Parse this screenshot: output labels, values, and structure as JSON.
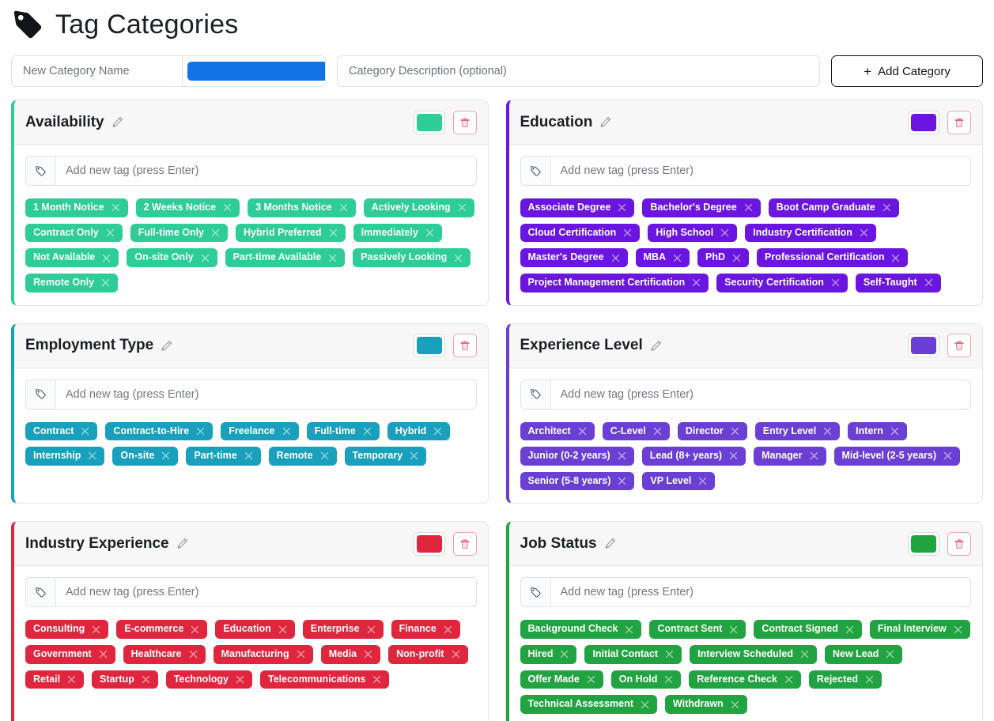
{
  "header": {
    "title": "Tag Categories",
    "logo_icon": "tag-icon"
  },
  "new_category_form": {
    "name_placeholder": "New Category Name",
    "name_value": "",
    "color_value": "#1273e6",
    "description_placeholder": "Category Description (optional)",
    "description_value": "",
    "add_button_label": "Add Category",
    "add_button_plus": "+"
  },
  "tag_input_placeholder": "Add new tag (press Enter)",
  "categories": [
    {
      "name": "Availability",
      "color": "#2ecc96",
      "tags": [
        "1 Month Notice",
        "2 Weeks Notice",
        "3 Months Notice",
        "Actively Looking",
        "Contract Only",
        "Full-time Only",
        "Hybrid Preferred",
        "Immediately",
        "Not Available",
        "On-site Only",
        "Part-time Available",
        "Passively Looking",
        "Remote Only"
      ]
    },
    {
      "name": "Education",
      "color": "#6a16e0",
      "tags": [
        "Associate Degree",
        "Bachelor's Degree",
        "Boot Camp Graduate",
        "Cloud Certification",
        "High School",
        "Industry Certification",
        "Master's Degree",
        "MBA",
        "PhD",
        "Professional Certification",
        "Project Management Certification",
        "Security Certification",
        "Self-Taught"
      ]
    },
    {
      "name": "Employment Type",
      "color": "#18a0bd",
      "tags": [
        "Contract",
        "Contract-to-Hire",
        "Freelance",
        "Full-time",
        "Hybrid",
        "Internship",
        "On-site",
        "Part-time",
        "Remote",
        "Temporary"
      ]
    },
    {
      "name": "Experience Level",
      "color": "#6b3fd4",
      "tags": [
        "Architect",
        "C-Level",
        "Director",
        "Entry Level",
        "Intern",
        "Junior (0-2 years)",
        "Lead (8+ years)",
        "Manager",
        "Mid-level (2-5 years)",
        "Senior (5-8 years)",
        "VP Level"
      ]
    },
    {
      "name": "Industry Experience",
      "color": "#e0263f",
      "tags": [
        "Consulting",
        "E-commerce",
        "Education",
        "Enterprise",
        "Finance",
        "Government",
        "Healthcare",
        "Manufacturing",
        "Media",
        "Non-profit",
        "Retail",
        "Startup",
        "Technology",
        "Telecommunications"
      ]
    },
    {
      "name": "Job Status",
      "color": "#22a341",
      "tags": [
        "Background Check",
        "Contract Sent",
        "Contract Signed",
        "Final Interview",
        "Hired",
        "Initial Contact",
        "Interview Scheduled",
        "New Lead",
        "Offer Made",
        "On Hold",
        "Reference Check",
        "Rejected",
        "Technical Assessment",
        "Withdrawn"
      ]
    }
  ]
}
